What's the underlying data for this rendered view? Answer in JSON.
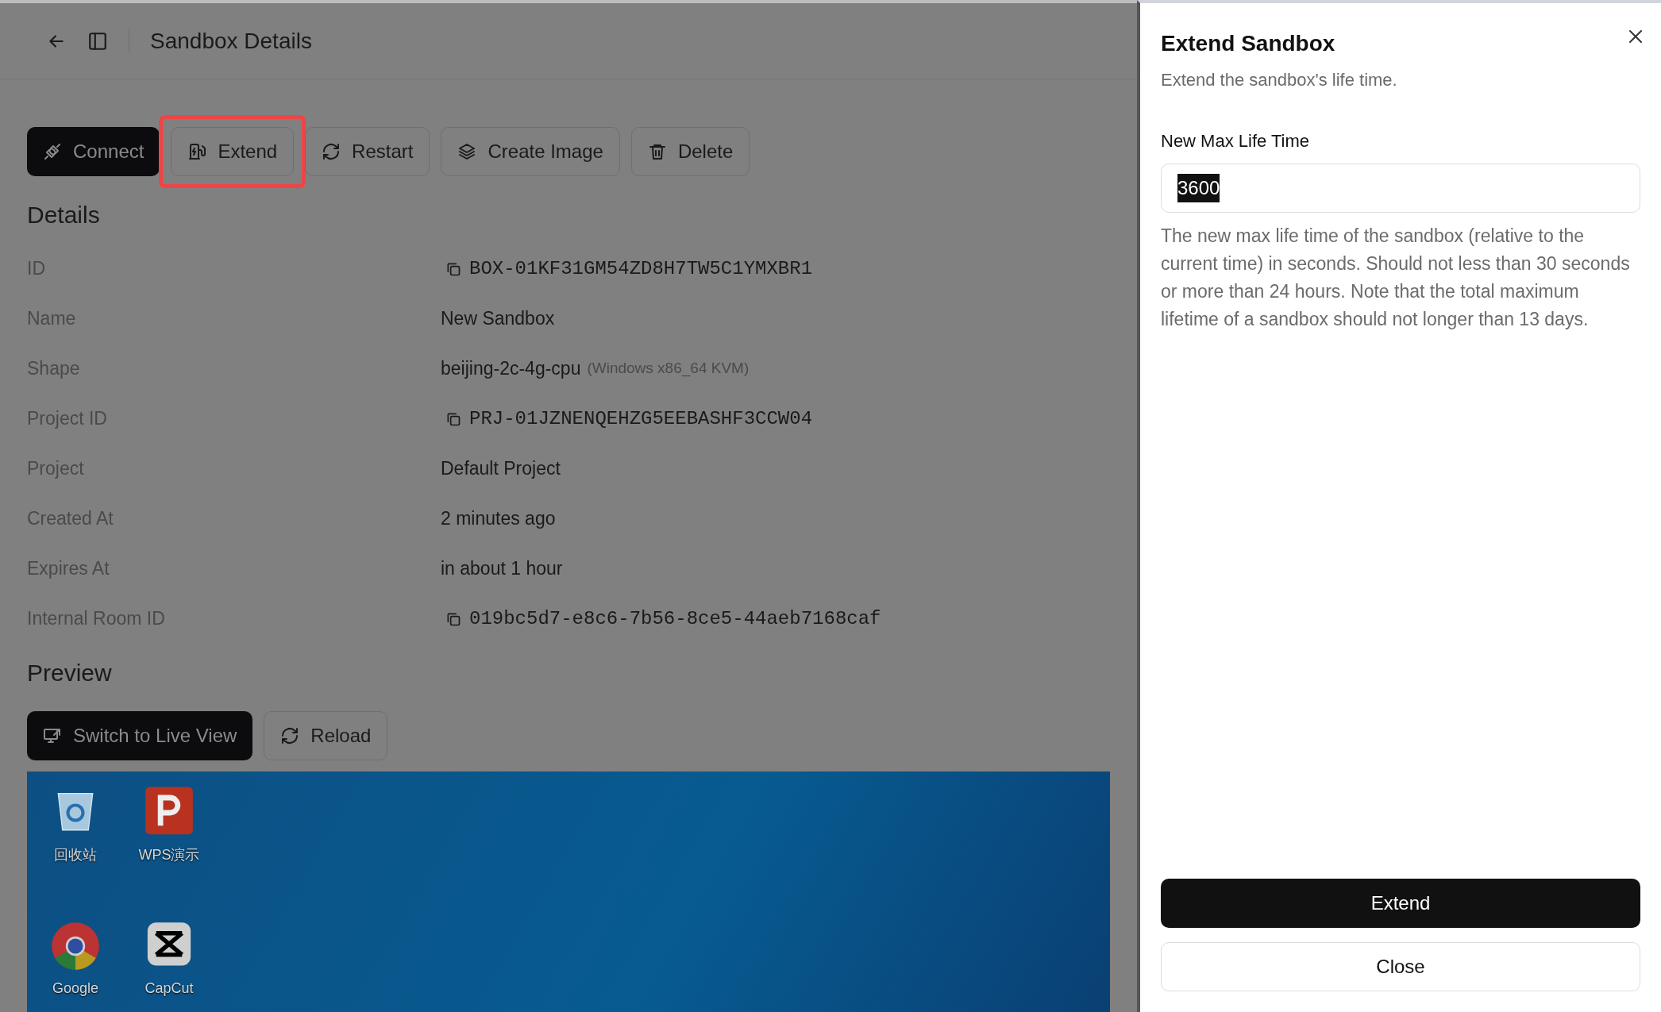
{
  "header": {
    "title": "Sandbox Details"
  },
  "actions": [
    {
      "label": "Connect",
      "kind": "connect",
      "primary": true,
      "highlighted": false
    },
    {
      "label": "Extend",
      "kind": "extend",
      "primary": false,
      "highlighted": true
    },
    {
      "label": "Restart",
      "kind": "restart",
      "primary": false,
      "highlighted": false
    },
    {
      "label": "Create Image",
      "kind": "image",
      "primary": false,
      "highlighted": false
    },
    {
      "label": "Delete",
      "kind": "delete",
      "primary": false,
      "highlighted": false
    }
  ],
  "details": {
    "title": "Details",
    "rows": [
      {
        "label": "ID",
        "value": "BOX-01KF31GM54ZD8H7TW5C1YMXBR1",
        "kind": "copy"
      },
      {
        "label": "Name",
        "value": "New Sandbox",
        "kind": "text"
      },
      {
        "label": "Shape",
        "value": "beijing-2c-4g-cpu",
        "note": "(Windows x86_64 KVM)",
        "kind": "text"
      },
      {
        "label": "Project ID",
        "value": "PRJ-01JZNENQEHZG5EEBASHF3CCW04",
        "kind": "copy"
      },
      {
        "label": "Project",
        "value": "Default Project",
        "kind": "text"
      },
      {
        "label": "Created At",
        "value": "2 minutes ago",
        "kind": "text"
      },
      {
        "label": "Expires At",
        "value": "in about 1 hour",
        "kind": "text"
      },
      {
        "label": "Internal Room ID",
        "value": "019bc5d7-e8c6-7b56-8ce5-44aeb7168caf",
        "kind": "copy"
      }
    ]
  },
  "preview": {
    "title": "Preview",
    "buttons": [
      {
        "label": "Switch to Live View",
        "kind": "live",
        "primary": true
      },
      {
        "label": "Reload",
        "kind": "reload",
        "primary": false
      }
    ],
    "desktop_icons": [
      {
        "label": "回收站",
        "kind": "bin"
      },
      {
        "label": "WPS演示",
        "kind": "wps"
      },
      {
        "label": "Google",
        "kind": "chrome"
      },
      {
        "label": "CapCut",
        "kind": "capcut"
      }
    ]
  },
  "dialog": {
    "title": "Extend Sandbox",
    "subtitle": "Extend the sandbox's life time.",
    "field_label": "New Max Life Time",
    "value": "3600",
    "value_selected": true,
    "help": "The new max life time of the sandbox (relative to the current time) in seconds. Should not less than 30 seconds or more than 24 hours. Note that the total maximum lifetime of a sandbox should not longer than 13 days.",
    "buttons": [
      {
        "label": "Extend",
        "primary": true
      },
      {
        "label": "Close",
        "primary": false
      }
    ]
  }
}
